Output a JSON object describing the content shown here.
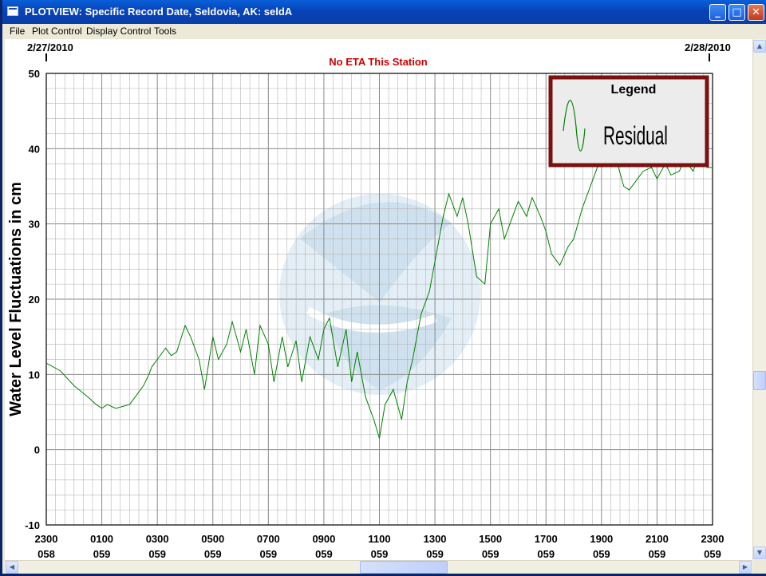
{
  "window": {
    "title": "PLOTVIEW: Specific Record Date, Seldovia, AK: seldA",
    "controls": {
      "minimize": "_",
      "maximize": "□",
      "close": "✕"
    }
  },
  "menu": [
    "File",
    "Plot Control",
    "Display Control",
    "Tools"
  ],
  "plot": {
    "start_date": "2/27/2010",
    "end_date": "2/28/2010",
    "status_message": "No ETA This Station",
    "ylabel": "Water Level Fluctuations in cm",
    "legend_title": "Legend",
    "colors": {
      "series": "#008000",
      "status": "#cc0000",
      "legend_border": "#7a1010",
      "grid": "#b4b4b4",
      "watermark": "#d7e6f1"
    },
    "watermark_icon": "noaa-logo"
  },
  "chart_data": {
    "type": "line",
    "title": "No ETA This Station",
    "ylabel": "Water Level Fluctuations in cm",
    "xlabel": "",
    "ylim": [
      -10,
      50
    ],
    "yticks": [
      -10,
      0,
      10,
      20,
      30,
      40,
      50
    ],
    "xlim_hours": [
      0,
      24
    ],
    "x_ticks": [
      {
        "time": "2300",
        "day": "058"
      },
      {
        "time": "0100",
        "day": "059"
      },
      {
        "time": "0300",
        "day": "059"
      },
      {
        "time": "0500",
        "day": "059"
      },
      {
        "time": "0700",
        "day": "059"
      },
      {
        "time": "0900",
        "day": "059"
      },
      {
        "time": "1100",
        "day": "059"
      },
      {
        "time": "1300",
        "day": "059"
      },
      {
        "time": "1500",
        "day": "059"
      },
      {
        "time": "1700",
        "day": "059"
      },
      {
        "time": "1900",
        "day": "059"
      },
      {
        "time": "2100",
        "day": "059"
      },
      {
        "time": "2300",
        "day": "059"
      }
    ],
    "grid": true,
    "legend_position": "top-right",
    "series": [
      {
        "name": "Residual",
        "color": "#008000",
        "x_hours": [
          0,
          0.5,
          1,
          1.5,
          1.8,
          2,
          2.2,
          2.5,
          3,
          3.3,
          3.5,
          3.7,
          3.8,
          4,
          4.2,
          4.3,
          4.5,
          4.7,
          5,
          5.2,
          5.5,
          5.7,
          6,
          6.2,
          6.5,
          6.7,
          7,
          7.2,
          7.5,
          7.7,
          8,
          8.2,
          8.5,
          8.7,
          9,
          9.2,
          9.5,
          9.8,
          10,
          10.2,
          10.5,
          10.8,
          11,
          11.2,
          11.5,
          11.8,
          12,
          12.2,
          12.5,
          12.8,
          13,
          13.2,
          13.5,
          13.8,
          14,
          14.3,
          14.5,
          14.8,
          15,
          15.2,
          15.5,
          15.8,
          16,
          16.3,
          16.5,
          16.8,
          17,
          17.3,
          17.5,
          17.8,
          18,
          18.2,
          18.5,
          18.8,
          19,
          19.3,
          19.5,
          19.8,
          20,
          20.2,
          20.5,
          20.8,
          21,
          21.3,
          21.5,
          21.8,
          22,
          22.3,
          22.5,
          22.8,
          23,
          23.3,
          23.5,
          23.8,
          24
        ],
        "values": [
          11.5,
          10.5,
          8.5,
          7.0,
          6.0,
          5.5,
          6.0,
          5.5,
          6.0,
          7.5,
          8.5,
          10.0,
          11.0,
          12.0,
          13.0,
          13.5,
          12.5,
          13.0,
          16.5,
          15.0,
          12.0,
          8.0,
          15.0,
          12.0,
          14.0,
          17.0,
          13.0,
          16.0,
          10.0,
          16.5,
          14.0,
          9.0,
          15.0,
          11.0,
          14.5,
          9.0,
          15.0,
          12.0,
          16.0,
          17.5,
          11.0,
          16.0,
          9.0,
          13.0,
          7.0,
          4.0,
          1.5,
          6.0,
          8.0,
          4.0,
          9.0,
          12.0,
          18.0,
          21.0,
          25.0,
          31.0,
          34.0,
          31.0,
          33.5,
          30.0,
          23.0,
          22.0,
          30.0,
          32.0,
          28.0,
          31.0,
          33.0,
          31.0,
          33.5,
          31.0,
          29.0,
          26.0,
          24.5,
          27.0,
          28.0,
          32.0,
          34.0,
          37.0,
          39.0,
          42.0,
          39.0,
          35.0,
          34.5,
          36.0,
          37.0,
          37.5,
          36.0,
          38.0,
          36.5,
          37.0,
          38.5,
          37.0,
          39.0,
          37.5,
          37.5
        ]
      }
    ]
  },
  "scrollbars": {
    "vertical_position": 0.67,
    "horizontal_position": 0.54
  }
}
